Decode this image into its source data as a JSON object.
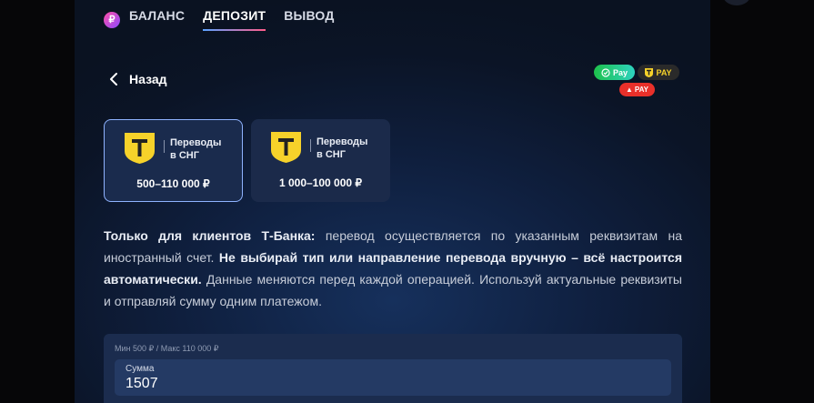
{
  "tabs": {
    "currency_symbol": "₽",
    "items": [
      {
        "label": "БАЛАНС",
        "active": false
      },
      {
        "label": "ДЕПОЗИТ",
        "active": true
      },
      {
        "label": "ВЫВОД",
        "active": false
      }
    ]
  },
  "back": {
    "label": "Назад"
  },
  "pay_badges": {
    "sber": "Pay",
    "tbank": "PAY",
    "alfa": "PAY"
  },
  "methods": [
    {
      "icon_letter": "T",
      "title_line1": "Переводы",
      "title_line2": "в СНГ",
      "range": "500–110 000 ₽",
      "selected": true
    },
    {
      "icon_letter": "T",
      "title_line1": "Переводы",
      "title_line2": "в СНГ",
      "range": "1 000–100 000 ₽",
      "selected": false
    }
  ],
  "info": {
    "bold1": "Только для клиентов Т-Банка:",
    "text1": " перевод осуществляется по указанным реквизитам на иностранный счет. ",
    "bold2": "Не выбирай тип или направление перевода вручную – всё настроится автоматически.",
    "text2": " Данные меняются перед каждой операцией. Используй актуальные реквизиты и отправляй сумму одним платежом."
  },
  "amount": {
    "limits": "Мин 500 ₽ / Макс 110 000 ₽",
    "label": "Сумма",
    "value": "1507"
  },
  "colors": {
    "accent_gradient_start": "#5aa2ff",
    "accent_gradient_end": "#ff5c8a",
    "tbank_yellow": "#f6d22a",
    "selected_border": "#8fb3ff"
  },
  "icons": {
    "back": "chevron-left-icon",
    "method": "tbank-shield-icon",
    "currency": "ruble-icon"
  }
}
